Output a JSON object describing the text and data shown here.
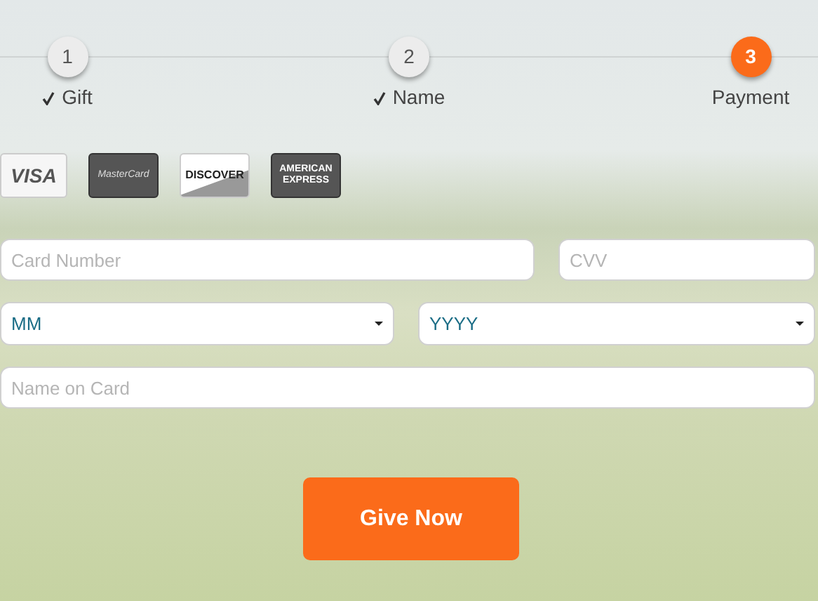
{
  "steps": [
    {
      "number": "1",
      "label": "Gift",
      "completed": true,
      "selected": false
    },
    {
      "number": "2",
      "label": "Name",
      "completed": true,
      "selected": false
    },
    {
      "number": "3",
      "label": "Payment",
      "completed": false,
      "selected": true
    }
  ],
  "cards": [
    {
      "kind": "visa",
      "label": "VISA"
    },
    {
      "kind": "mastercard",
      "label": "MasterCard"
    },
    {
      "kind": "discover",
      "label": "DISCOVER"
    },
    {
      "kind": "amex",
      "label": "AMERICAN EXPRESS"
    }
  ],
  "card_number": {
    "placeholder": "Card Number"
  },
  "cvv": {
    "placeholder": "CVV"
  },
  "month": {
    "value": "MM"
  },
  "year": {
    "value": "YYYY"
  },
  "name_on_card": {
    "placeholder": "Name on Card"
  },
  "submit_button": "Give Now"
}
